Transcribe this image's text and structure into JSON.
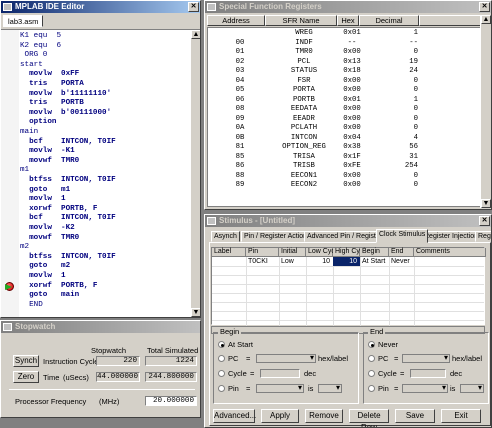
{
  "editor": {
    "title": "MPLAB IDE Editor",
    "tab": "lab3.asm",
    "lines": [
      {
        "t": "K1 equ  5",
        "b": false
      },
      {
        "t": "K2 equ  6",
        "b": false
      },
      {
        "t": " ORG 0",
        "b": false
      },
      {
        "t": "start",
        "b": false
      },
      {
        "t": "  movlw  0xFF",
        "b": true,
        "k": "movlw"
      },
      {
        "t": "  tris   PORTA",
        "b": true,
        "k": "tris"
      },
      {
        "t": "  movlw  b'11111110'",
        "b": true,
        "k": "movlw"
      },
      {
        "t": "  tris   PORTB",
        "b": true,
        "k": "tris"
      },
      {
        "t": "  movlw  b'00111000'",
        "b": true,
        "k": "movlw"
      },
      {
        "t": "  option",
        "b": true,
        "k": "option"
      },
      {
        "t": "main",
        "b": false
      },
      {
        "t": "  bcf    INTCON, T0IF",
        "b": true,
        "k": "bcf"
      },
      {
        "t": "  movlw  -K1",
        "b": true,
        "k": "movlw"
      },
      {
        "t": "  movwf  TMR0",
        "b": true,
        "k": "movwf"
      },
      {
        "t": "m1",
        "b": false
      },
      {
        "t": "  btfss  INTCON, T0IF",
        "b": true,
        "k": "btfss"
      },
      {
        "t": "  goto   m1",
        "b": true,
        "k": "goto"
      },
      {
        "t": "  movlw  1",
        "b": true,
        "k": "movlw"
      },
      {
        "t": "  xorwf  PORTB, F",
        "b": true,
        "k": "xorwf"
      },
      {
        "t": "  bcf    INTCON, T0IF",
        "b": true,
        "k": "bcf"
      },
      {
        "t": "  movlw  -K2",
        "b": true,
        "k": "movlw"
      },
      {
        "t": "  movwf  TMR0",
        "b": true,
        "k": "movwf"
      },
      {
        "t": "m2",
        "b": false
      },
      {
        "t": "  btfss  INTCON, T0IF",
        "b": true,
        "k": "btfss"
      },
      {
        "t": "  goto   m2",
        "b": true,
        "k": "goto"
      },
      {
        "t": "  movlw  1",
        "b": true,
        "k": "movlw"
      },
      {
        "t": "  xorwf  PORTB, F",
        "b": true,
        "k": "xorwf"
      },
      {
        "t": "  goto   main",
        "b": true,
        "k": "goto"
      },
      {
        "t": "  END",
        "b": false
      }
    ],
    "breakpoint_line": 26
  },
  "sfr": {
    "title": "Special Function Registers",
    "columns": [
      "Address",
      "SFR Name",
      "Hex",
      "Decimal"
    ],
    "rows": [
      [
        "",
        "WREG",
        "0x01",
        "1"
      ],
      [
        "00",
        "INDF",
        "--",
        "--"
      ],
      [
        "01",
        "TMR0",
        "0x00",
        "0"
      ],
      [
        "02",
        "PCL",
        "0x13",
        "19"
      ],
      [
        "03",
        "STATUS",
        "0x18",
        "24"
      ],
      [
        "04",
        "FSR",
        "0x00",
        "0"
      ],
      [
        "05",
        "PORTA",
        "0x00",
        "0"
      ],
      [
        "06",
        "PORTB",
        "0x01",
        "1"
      ],
      [
        "08",
        "EEDATA",
        "0x00",
        "0"
      ],
      [
        "09",
        "EEADR",
        "0x00",
        "0"
      ],
      [
        "0A",
        "PCLATH",
        "0x00",
        "0"
      ],
      [
        "0B",
        "INTCON",
        "0x04",
        "4"
      ],
      [
        "81",
        "OPTION_REG",
        "0x38",
        "56"
      ],
      [
        "85",
        "TRISA",
        "0x1F",
        "31"
      ],
      [
        "86",
        "TRISB",
        "0xFE",
        "254"
      ],
      [
        "88",
        "EECON1",
        "0x00",
        "0"
      ],
      [
        "89",
        "EECON2",
        "0x00",
        "0"
      ]
    ]
  },
  "stimulus": {
    "title": "Stimulus - [Untitled]",
    "tabs": [
      "Asynch",
      "Pin / Register Actions",
      "Advanced Pin / Register",
      "Clock Stimulus",
      "Register Injection",
      "Regi"
    ],
    "active_tab": 3,
    "columns": [
      "Label",
      "Pin",
      "Initial",
      "Low Cyc",
      "High Cycl",
      "Begin",
      "End",
      "Comments"
    ],
    "row": [
      "",
      "T0CKI",
      "Low",
      "10",
      "10",
      "At Start",
      "Never",
      ""
    ],
    "begin": {
      "label": "Begin",
      "options": [
        "At Start",
        "PC",
        "Cycle",
        "Pin"
      ],
      "selected": "At Start",
      "eq": "=",
      "hex_label": "hex/label",
      "dec": "dec",
      "is": "is"
    },
    "end": {
      "label": "End",
      "options": [
        "Never",
        "PC",
        "Cycle",
        "Pin"
      ],
      "selected": "Never",
      "eq": "=",
      "hex_label": "hex/label",
      "dec": "dec",
      "is": "is"
    },
    "buttons": [
      "Advanced...",
      "Apply",
      "Remove",
      "Delete Row",
      "Save",
      "Exit"
    ]
  },
  "stopwatch": {
    "title": "Stopwatch",
    "col_stopwatch": "Stopwatch",
    "col_total": "Total Simulated",
    "synch_label": "Synch",
    "zero_label": "Zero",
    "instr_label": "Instruction Cycles",
    "instr_sw": "220",
    "instr_total": "1224",
    "time_label": "Time",
    "time_unit": "(uSecs)",
    "time_sw": "44.000000",
    "time_total": "244.800000",
    "freq_label": "Processor Frequency",
    "freq_unit": "(MHz)",
    "freq_value": "20.000000"
  },
  "colors": {
    "title_active": "#0a246a",
    "title_inactive": "#808080",
    "highlight": "#0a246a",
    "face": "#d4d0c8"
  }
}
